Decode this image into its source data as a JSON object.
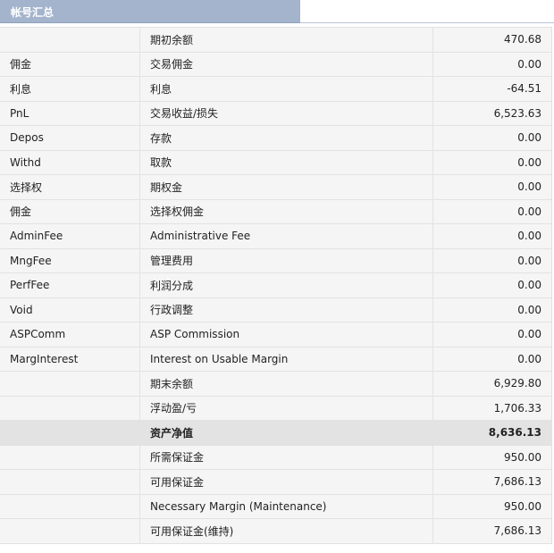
{
  "header": {
    "title": "帐号汇总"
  },
  "rows": [
    {
      "code": "",
      "label": "期初余额",
      "value": "470.68"
    },
    {
      "code": "佣金",
      "label": "交易佣金",
      "value": "0.00"
    },
    {
      "code": "利息",
      "label": "利息",
      "value": "-64.51"
    },
    {
      "code": "PnL",
      "label": "交易收益/损失",
      "value": "6,523.63"
    },
    {
      "code": "Depos",
      "label": "存款",
      "value": "0.00"
    },
    {
      "code": "Withd",
      "label": "取款",
      "value": "0.00"
    },
    {
      "code": "选择权",
      "label": "期权金",
      "value": "0.00"
    },
    {
      "code": "佣金",
      "label": "选择权佣金",
      "value": "0.00"
    },
    {
      "code": "AdminFee",
      "label": "Administrative Fee",
      "value": "0.00"
    },
    {
      "code": "MngFee",
      "label": "管理费用",
      "value": "0.00"
    },
    {
      "code": "PerfFee",
      "label": "利润分成",
      "value": "0.00"
    },
    {
      "code": "Void",
      "label": "行政调整",
      "value": "0.00"
    },
    {
      "code": "ASPComm",
      "label": "ASP Commission",
      "value": "0.00"
    },
    {
      "code": "MargInterest",
      "label": "Interest on Usable Margin",
      "value": "0.00"
    },
    {
      "code": "",
      "label": "期末余额",
      "value": "6,929.80"
    },
    {
      "code": "",
      "label": "浮动盈/亏",
      "value": "1,706.33"
    },
    {
      "code": "",
      "label": "资产净值",
      "value": "8,636.13",
      "highlight": true
    },
    {
      "code": "",
      "label": "所需保证金",
      "value": "950.00"
    },
    {
      "code": "",
      "label": "可用保证金",
      "value": "7,686.13"
    },
    {
      "code": "",
      "label": "Necessary Margin (Maintenance)",
      "value": "950.00"
    },
    {
      "code": "",
      "label": "可用保证金(维持)",
      "value": "7,686.13"
    }
  ]
}
